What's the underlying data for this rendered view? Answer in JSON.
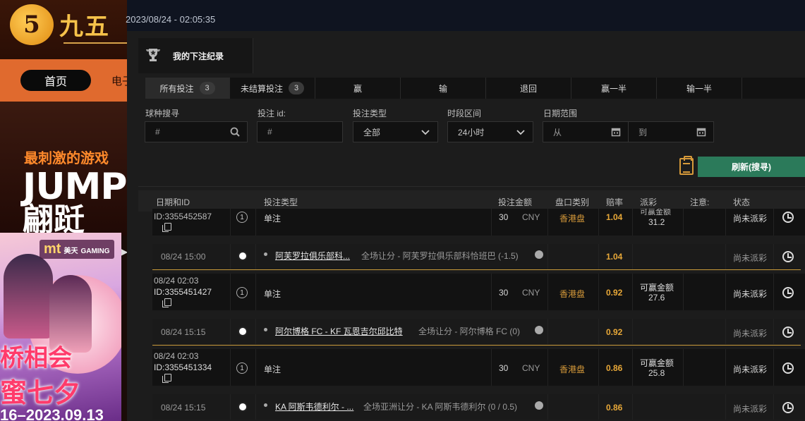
{
  "bg": {
    "logo_symbol": "5",
    "logo_text": "九五",
    "nav_home": "首页",
    "nav_next": "电子",
    "hero_sub": "最刺激的游戏",
    "hero_big": "JUMP U",
    "hero_big2": "翩跹",
    "promo_logo": "mt",
    "promo_logo_sub": "美天",
    "promo_logo_sub2": "GAMING",
    "promo_t1": "桥相会",
    "promo_t2": "蜜七夕",
    "promo_date": "16–2023.09.13"
  },
  "header": {
    "datetime": "2023/08/24 - 02:05:35",
    "title": "我的下注纪录"
  },
  "tabs": [
    {
      "label": "所有投注",
      "count": "3"
    },
    {
      "label": "未结算投注",
      "count": "3"
    },
    {
      "label": "赢"
    },
    {
      "label": "输"
    },
    {
      "label": "退回"
    },
    {
      "label": "赢一半"
    },
    {
      "label": "输一半"
    },
    {
      "label": ""
    }
  ],
  "filters": {
    "sport_label": "球种搜寻",
    "sport_placeholder": "#",
    "betid_label": "投注 id:",
    "betid_placeholder": "#",
    "bettype_label": "投注类型",
    "bettype_value": "全部",
    "period_label": "时段区间",
    "period_value": "24小时",
    "daterange_label": "日期范围",
    "from_placeholder": "从",
    "to_placeholder": "到",
    "refresh_label": "刷新(搜寻)"
  },
  "columns": {
    "date_id": "日期和ID",
    "bet_type": "投注类型",
    "amount": "投注金额",
    "market": "盘口类别",
    "odds": "赔率",
    "payout": "派彩",
    "note": "注意:",
    "status": "状态"
  },
  "bets": [
    {
      "id": "ID:3355452587",
      "type": "单注",
      "amount": "30",
      "currency": "CNY",
      "market": "香港盘",
      "odds": "1.04",
      "payout_label": "可赢金额",
      "payout": "31.2",
      "status": "尚未派彩",
      "event": {
        "time": "08/24 15:00",
        "match": "阿芙罗拉俱乐部科...",
        "selection": "全场让分 - 阿芙罗拉俱乐部科恰班巴 (-1.5)",
        "odds": "1.04",
        "status": "尚未派彩"
      }
    },
    {
      "date": "08/24 02:03",
      "id": "ID:3355451427",
      "type": "单注",
      "amount": "30",
      "currency": "CNY",
      "market": "香港盘",
      "odds": "0.92",
      "payout_label": "可赢金额",
      "payout": "27.6",
      "status": "尚未派彩",
      "event": {
        "time": "08/24 15:15",
        "match": "阿尔博格 FC - KF 瓦恩吉尔邱比特",
        "selection": "全场让分 - 阿尔博格 FC (0)",
        "odds": "0.92",
        "status": "尚未派彩"
      }
    },
    {
      "date": "08/24 02:03",
      "id": "ID:3355451334",
      "type": "单注",
      "amount": "30",
      "currency": "CNY",
      "market": "香港盘",
      "odds": "0.86",
      "payout_label": "可赢金额",
      "payout": "25.8",
      "status": "尚未派彩",
      "event": {
        "time": "08/24 15:15",
        "match": "KA 阿斯韦德利尔 - ...",
        "selection": "全场亚洲让分 - KA 阿斯韦德利尔 (0 / 0.5)",
        "odds": "0.86",
        "status": "尚未派彩"
      }
    }
  ]
}
